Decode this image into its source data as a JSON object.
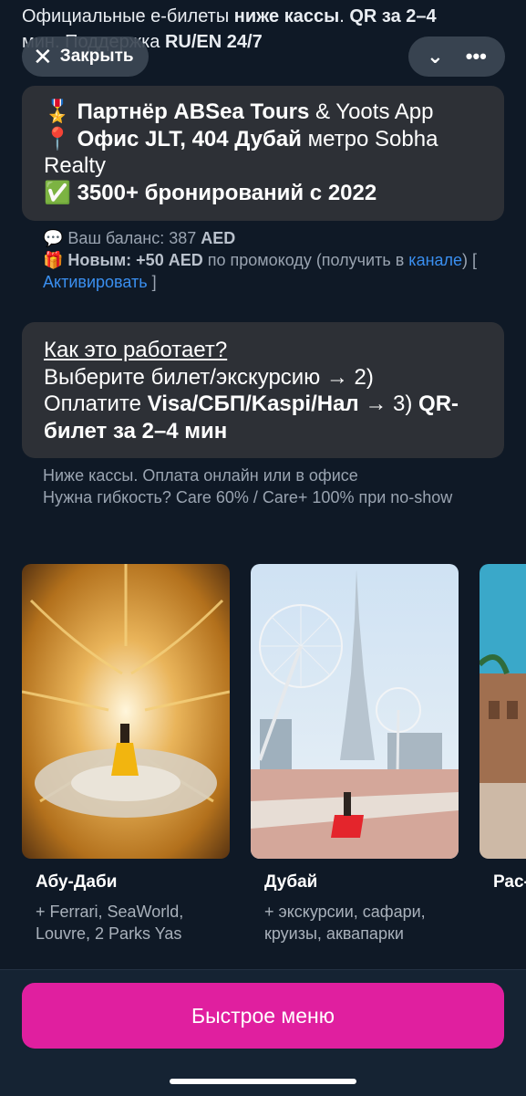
{
  "header": {
    "line1_normal": "Официальные е-билеты ",
    "line1_bold": "ниже кассы",
    "line1_sep": ". ",
    "line1_bold2": "QR за 2–4",
    "line2_normal": "мин. Поддержка ",
    "line2_bold": "RU/EN 24/7"
  },
  "topbar": {
    "close_icon": "close-icon",
    "close_label": "Закрыть",
    "chevron_icon": "chevron-down-icon",
    "more_icon": "more-dots-icon"
  },
  "card1": {
    "l1_emoji": "🎖️",
    "l1_bold": "Партнёр ABSea Tours",
    "l1_normal": " & Yoots App",
    "l2_emoji": "📍",
    "l2_bold": "Офис JLT, 404 Дубай",
    "l2_normal": " метро Sobha Realty",
    "l3_emoji": "✅",
    "l3_bold": "3500+ бронирований с 2022"
  },
  "balance": {
    "l1_emoji": "💬",
    "l1_text": " Ваш баланс: 387 ",
    "l1_bold": "AED",
    "l2_emoji": "🎁",
    "l2_bold": " Новым: +50 AED",
    "l2_text": " по промокоду (получить в ",
    "l2_link": "канале",
    "l2_after": ") [ ",
    "l2_activate": "Активировать",
    "l2_end": " ]"
  },
  "card2": {
    "title": "Как это работает?",
    "step1": "Выберите билет/экскурсию → 2)",
    "step2_normal": "Оплатите ",
    "step2_bold": "Visa/СБП/Kaspi/Нал",
    "step2_after": " → 3) ",
    "step2_bold2": "QR-билет за 2–4 мин"
  },
  "note": {
    "line1": "Ниже кассы. Оплата онлайн или в офисе",
    "line2": "Нужна гибкость? Care 60% / Care+ 100% при no-show"
  },
  "tiles": [
    {
      "title": "Абу-Даби",
      "subtitle": "+ Ferrari, SeaWorld, Louvre, 2 Parks Yas"
    },
    {
      "title": "Дубай",
      "subtitle": "+ экскурсии, сафари, круизы, аквапарки"
    },
    {
      "title": "Рас-",
      "subtitle": ""
    }
  ],
  "footer": {
    "button_label": "Быстрое меню"
  },
  "colors": {
    "background": "#0f1926",
    "card": "#2d3036",
    "accent": "#e01f9f",
    "link": "#3a8ff0"
  }
}
